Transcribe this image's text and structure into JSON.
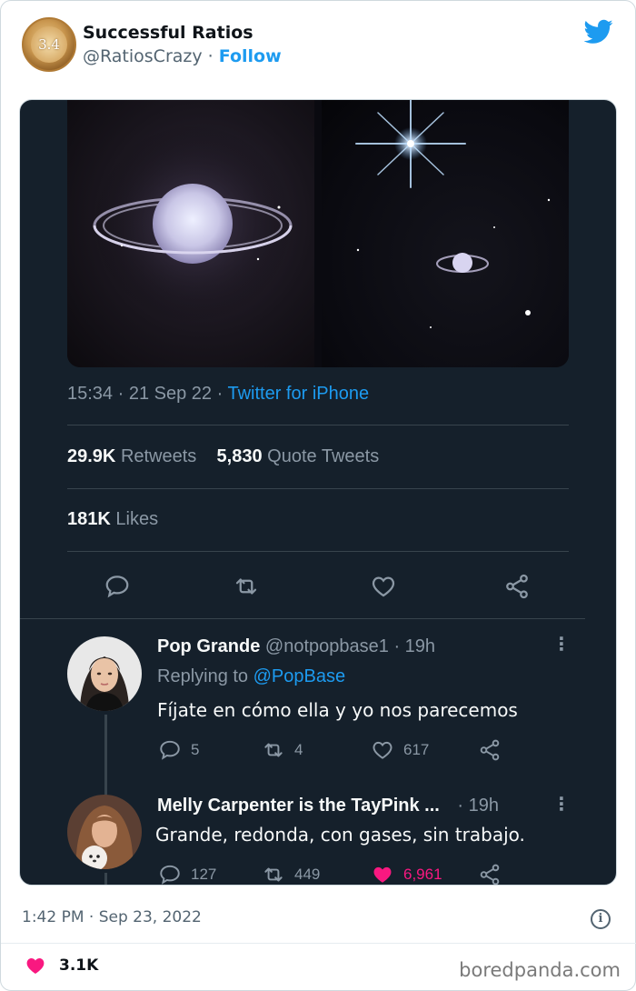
{
  "author": {
    "avatar_text": "3.4",
    "name": "Successful Ratios",
    "handle": "@RatiosCrazy",
    "separator": "·",
    "follow_label": "Follow"
  },
  "screenshot": {
    "tweet_meta": {
      "time": "15:34",
      "date": "21 Sep 22",
      "source": "Twitter for iPhone"
    },
    "stats": {
      "retweets_count": "29.9K",
      "retweets_label": "Retweets",
      "quotes_count": "5,830",
      "quotes_label": "Quote Tweets",
      "likes_count": "181K",
      "likes_label": "Likes"
    },
    "replies": [
      {
        "name": "Pop Grande",
        "handle": "@notpopbase1",
        "age": "· 19h",
        "replying_prefix": "Replying to",
        "replying_to": "@PopBase",
        "text": "Fíjate en cómo ella y yo nos parecemos",
        "reply_count": "5",
        "retweet_count": "4",
        "like_count": "617"
      },
      {
        "name": "Melly Carpenter is the TayPink ...",
        "handle": "",
        "age": "· 19h",
        "text": "Grande, redonda, con gases, sin trabajo.",
        "reply_count": "127",
        "retweet_count": "449",
        "like_count": "6,961"
      }
    ]
  },
  "footer": {
    "timestamp": "1:42 PM · Sep 23, 2022",
    "info_glyph": "i",
    "like_count": "3.1K",
    "watermark": "boredpanda.com"
  },
  "colors": {
    "accent": "#1d9bf0",
    "dark_bg": "#15202b",
    "muted_dark": "#8b98a5",
    "like_pink": "#f91880"
  },
  "icons": [
    "twitter-bird-icon",
    "reply-icon",
    "retweet-icon",
    "like-icon",
    "share-icon",
    "more-icon",
    "info-icon",
    "heart-filled-icon"
  ]
}
